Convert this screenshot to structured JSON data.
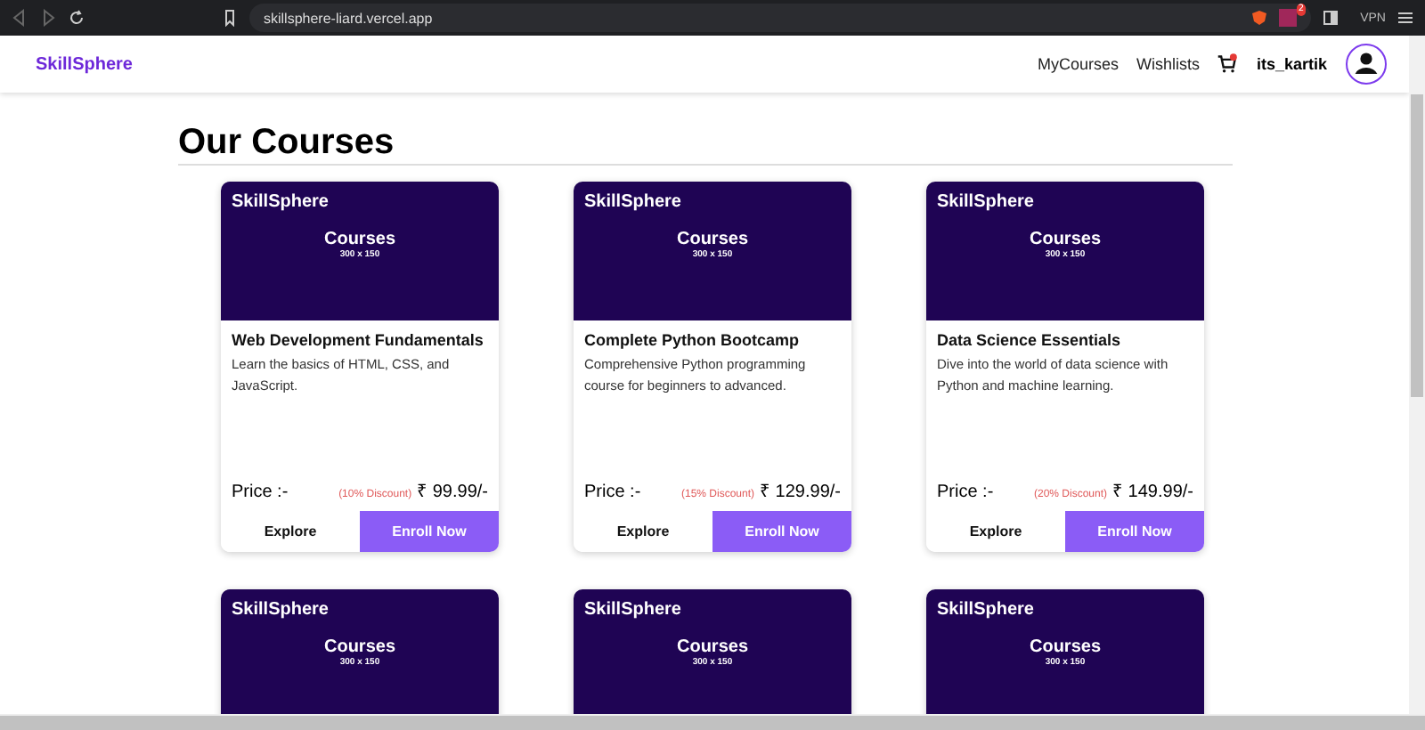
{
  "browser": {
    "url": "skillsphere-liard.vercel.app",
    "vpn": "VPN",
    "badge": "2"
  },
  "navbar": {
    "brand": "SkillSphere",
    "links": [
      "MyCourses",
      "Wishlists"
    ],
    "cart_has_items": true,
    "username": "its_kartik"
  },
  "heading": "Our Courses",
  "courses": [
    {
      "banner": {
        "brand": "SkillSphere",
        "title": "Courses",
        "size": "300 x 150"
      },
      "title": "Web Development Fundamentals",
      "description": "Learn the basics of HTML, CSS, and JavaScript.",
      "price_label": "Price :-",
      "discount": "(10% Discount)",
      "price": "₹ 99.99/-",
      "explore": "Explore",
      "enroll": "Enroll Now"
    },
    {
      "banner": {
        "brand": "SkillSphere",
        "title": "Courses",
        "size": "300 x 150"
      },
      "title": "Complete Python Bootcamp",
      "description": "Comprehensive Python programming course for beginners to advanced.",
      "price_label": "Price :-",
      "discount": "(15% Discount)",
      "price": "₹ 129.99/-",
      "explore": "Explore",
      "enroll": "Enroll Now"
    },
    {
      "banner": {
        "brand": "SkillSphere",
        "title": "Courses",
        "size": "300 x 150"
      },
      "title": "Data Science Essentials",
      "description": "Dive into the world of data science with Python and machine learning.",
      "price_label": "Price :-",
      "discount": "(20% Discount)",
      "price": "₹ 149.99/-",
      "explore": "Explore",
      "enroll": "Enroll Now"
    },
    {
      "banner": {
        "brand": "SkillSphere",
        "title": "Courses",
        "size": "300 x 150"
      }
    },
    {
      "banner": {
        "brand": "SkillSphere",
        "title": "Courses",
        "size": "300 x 150"
      }
    },
    {
      "banner": {
        "brand": "SkillSphere",
        "title": "Courses",
        "size": "300 x 150"
      }
    }
  ]
}
